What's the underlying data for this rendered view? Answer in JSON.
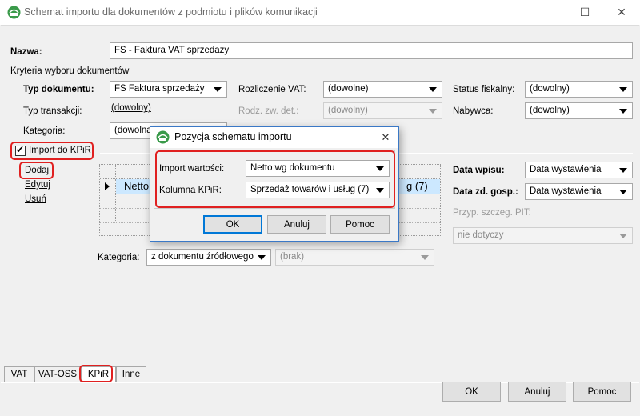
{
  "window": {
    "title": "Schemat importu dla dokumentów z podmiotu i plików komunikacji",
    "minimize_glyph": "—",
    "maximize_glyph": "☐",
    "close_glyph": "✕"
  },
  "form": {
    "nazwa_label": "Nazwa:",
    "nazwa_value": "FS - Faktura VAT sprzedaży",
    "kryteria_label": "Kryteria wyboru dokumentów",
    "typ_dok_label": "Typ dokumentu:",
    "typ_dok_value": "FS Faktura sprzedaży",
    "rozl_vat_label": "Rozliczenie VAT:",
    "rozl_vat_value": "(dowolne)",
    "status_fisk_label": "Status fiskalny:",
    "status_fisk_value": "(dowolny)",
    "typ_trans_label": "Typ transakcji:",
    "typ_trans_value": "(dowolny)",
    "rodz_zw_label": "Rodz. zw. det.:",
    "rodz_zw_value": "(dowolny)",
    "nabywca_label": "Nabywca:",
    "nabywca_value": "(dowolny)",
    "kategoria_label": "Kategoria:",
    "kategoria_value": "(dowolna)",
    "import_kpir_label": "Import do KPiR",
    "import_kpir_checked": "✔"
  },
  "actions": {
    "dodaj": "Dodaj",
    "edytuj": "Edytuj",
    "usun": "Usuń"
  },
  "grid": {
    "row1_text": "Netto",
    "row1_right": "g (7)"
  },
  "right_panel": {
    "data_wpisu_label": "Data wpisu:",
    "data_wpisu_value": "Data wystawienia",
    "data_zd_label": "Data zd. gosp.:",
    "data_zd_value": "Data wystawienia",
    "przyp_label": "Przyp. szczeg. PIT:",
    "przyp_value": "nie dotyczy"
  },
  "bottom_kategoria": {
    "label": "Kategoria:",
    "value": "z dokumentu źródłowego",
    "brak": "(brak)"
  },
  "tabs": [
    "VAT",
    "VAT-OSS",
    "KPiR",
    "Inne"
  ],
  "buttons": {
    "ok": "OK",
    "anuluj": "Anuluj",
    "pomoc": "Pomoc"
  },
  "modal": {
    "title": "Pozycja schematu importu",
    "close_glyph": "✕",
    "import_wartosci_label": "Import wartości:",
    "import_wartosci_value": "Netto wg dokumentu",
    "kolumna_label": "Kolumna KPiR:",
    "kolumna_value": "Sprzedaż towarów i usług (7)",
    "ok": "OK",
    "anuluj": "Anuluj",
    "pomoc": "Pomoc"
  },
  "colors": {
    "highlight": "#e02020",
    "selection": "#cce8ff",
    "accent": "#0078d7"
  }
}
